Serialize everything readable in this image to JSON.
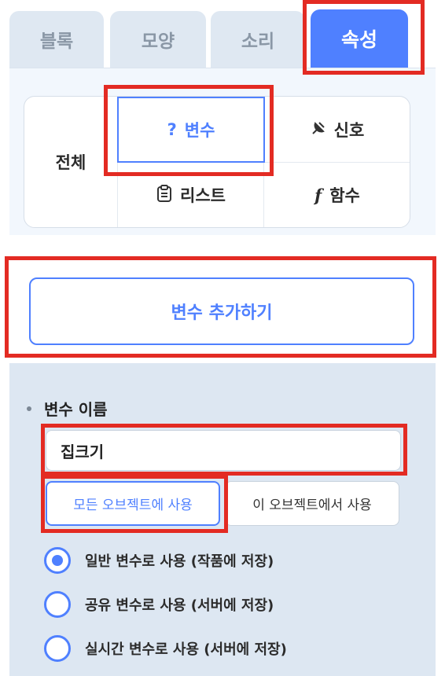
{
  "tabs": [
    {
      "label": "블록"
    },
    {
      "label": "모양"
    },
    {
      "label": "소리"
    },
    {
      "label": "속성"
    }
  ],
  "categories": {
    "all": "전체",
    "variable": {
      "icon": "?",
      "label": "변수"
    },
    "signal": {
      "icon": "satellite-icon",
      "label": "신호"
    },
    "list": {
      "icon": "clipboard-icon",
      "label": "리스트"
    },
    "function": {
      "icon": "f",
      "label": "함수"
    }
  },
  "add_variable_button": "변수 추가하기",
  "form": {
    "name_label": "변수 이름",
    "name_value": "집크기",
    "scope_all": "모든 오브젝트에 사용",
    "scope_this": "이 오브젝트에서 사용",
    "radio_options": [
      {
        "label": "일반 변수로 사용 (작품에 저장)",
        "checked": true
      },
      {
        "label": "공유 변수로 사용 (서버에 저장)",
        "checked": false
      },
      {
        "label": "실시간 변수로 사용 (서버에 저장)",
        "checked": false
      }
    ]
  },
  "colors": {
    "accent": "#4f80ff",
    "highlight": "#e32b23"
  }
}
